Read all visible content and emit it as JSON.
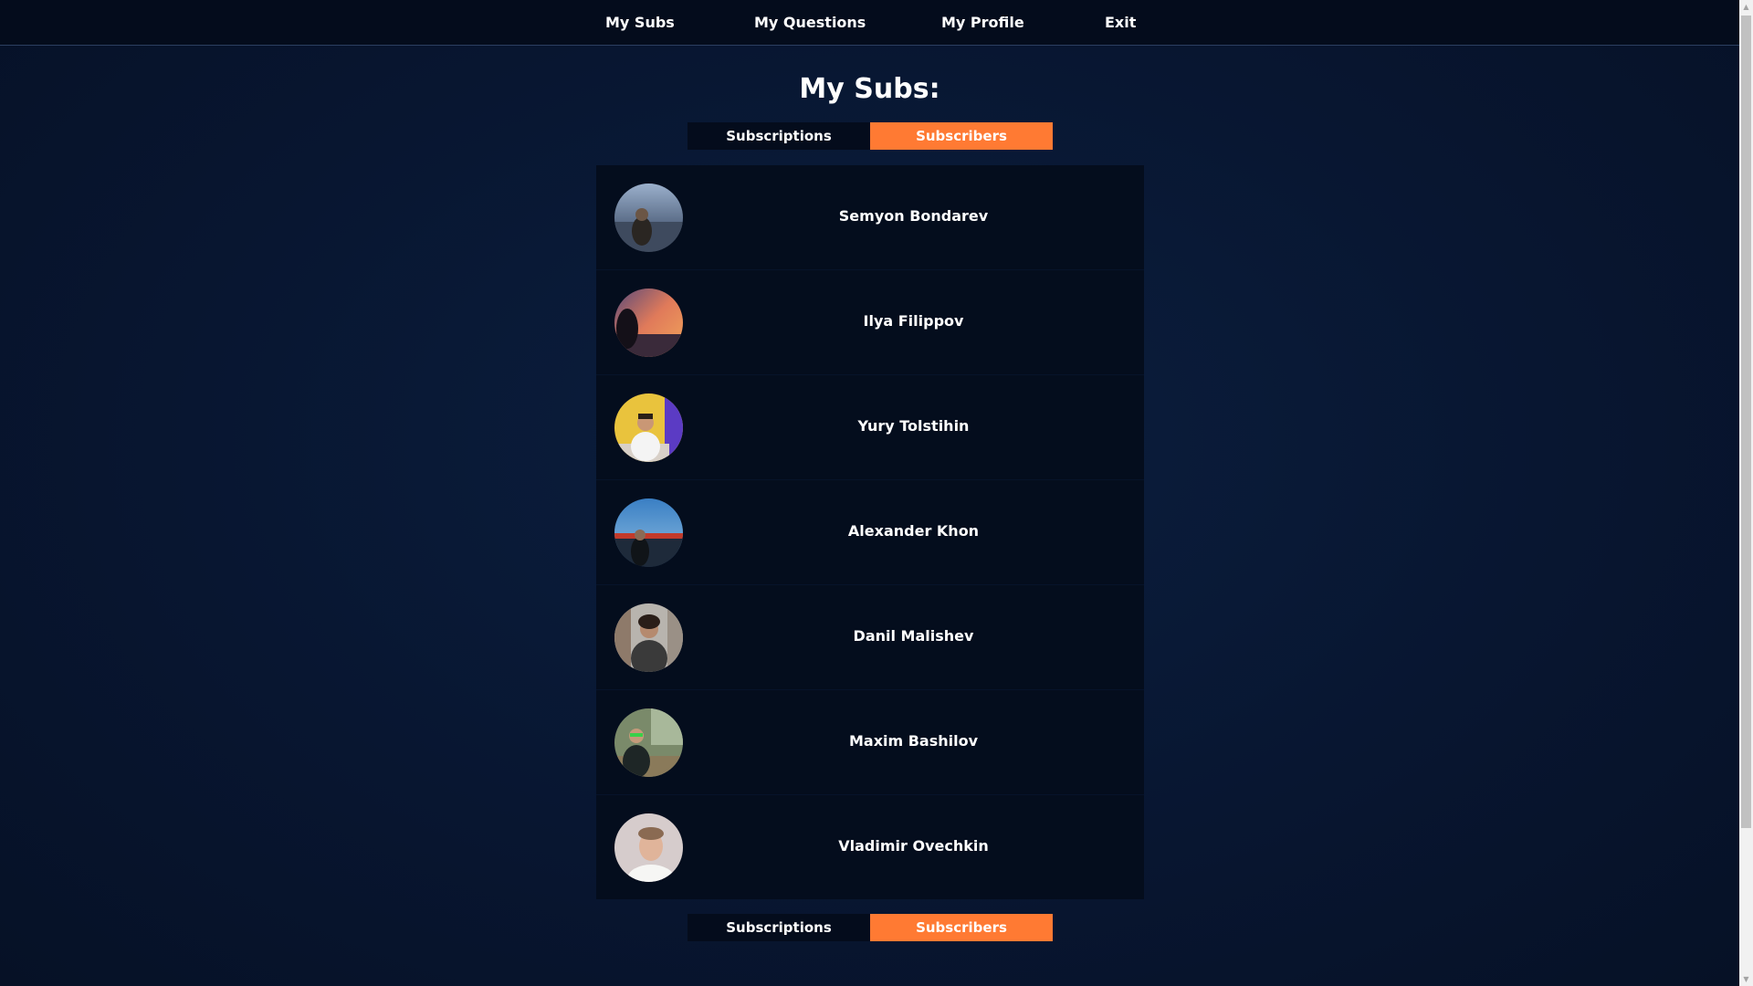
{
  "nav": {
    "items": [
      {
        "label": "My Subs"
      },
      {
        "label": "My Questions"
      },
      {
        "label": "My Profile"
      },
      {
        "label": "Exit"
      }
    ]
  },
  "main": {
    "title": "My Subs:",
    "tabs": [
      {
        "label": "Subscriptions",
        "active": false
      },
      {
        "label": "Subscribers",
        "active": true
      }
    ],
    "users": [
      {
        "name": "Semyon Bondarev",
        "avatar": "user-photo-lake"
      },
      {
        "name": "Ilya Filippov",
        "avatar": "user-photo-sunset"
      },
      {
        "name": "Yury Tolstihin",
        "avatar": "user-photo-yellow-room"
      },
      {
        "name": "Alexander Khon",
        "avatar": "user-photo-bridge"
      },
      {
        "name": "Danil Malishev",
        "avatar": "user-photo-street"
      },
      {
        "name": "Maxim Bashilov",
        "avatar": "user-photo-park"
      },
      {
        "name": "Vladimir Ovechkin",
        "avatar": "user-photo-portrait"
      }
    ]
  },
  "colors": {
    "background": "#081631",
    "nav_background": "#040c1c",
    "panel_background": "#040d1d",
    "accent": "#ff7a33"
  },
  "scrollbar": {
    "up_icon": "scroll-up-arrow-icon",
    "down_icon": "scroll-down-arrow-icon"
  }
}
